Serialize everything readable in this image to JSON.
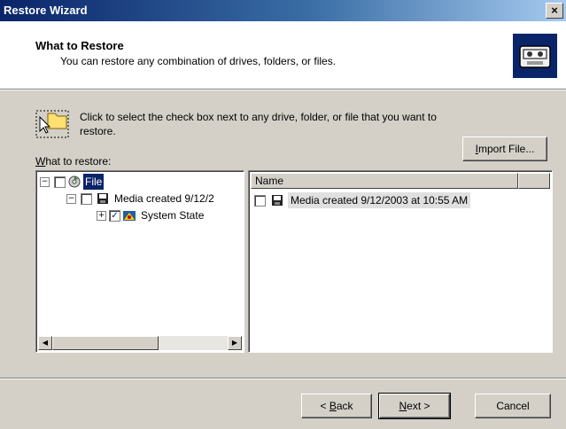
{
  "window": {
    "title": "Restore Wizard",
    "close_glyph": "×"
  },
  "header": {
    "title": "What to Restore",
    "subtitle": "You can restore any combination of drives, folders, or files.",
    "icon": "backup-restore-icon"
  },
  "instruction": {
    "icon": "cursor-folder-icon",
    "text": "Click to select the check box next to any drive, folder, or file that you want to restore."
  },
  "what_label": {
    "accel": "W",
    "rest": "hat to restore:"
  },
  "import_button": {
    "accel": "I",
    "rest": "mport File..."
  },
  "tree": {
    "nodes": [
      {
        "label": "File",
        "expander": "−",
        "checked": false,
        "selected": true,
        "icon": "backup-file-icon"
      },
      {
        "label": "Media created 9/12/2",
        "expander": "−",
        "checked": false,
        "selected": false,
        "icon": "media-icon"
      },
      {
        "label": "System State",
        "expander": "+",
        "checked": true,
        "selected": false,
        "icon": "system-state-icon"
      }
    ],
    "scroll_left": "◀",
    "scroll_right": "▶"
  },
  "list": {
    "columns": [
      "Name",
      ""
    ],
    "rows": [
      {
        "label": "Media created 9/12/2003 at 10:55 AM",
        "checked": false,
        "icon": "media-icon"
      }
    ]
  },
  "buttons": {
    "back": {
      "pre": "< ",
      "accel": "B",
      "rest": "ack"
    },
    "next": {
      "accel": "N",
      "rest": "ext >"
    },
    "cancel": "Cancel"
  },
  "colors": {
    "title_start": "#0a246a",
    "title_end": "#a6caf0",
    "selection": "#0a246a",
    "face": "#d4d0c8"
  }
}
